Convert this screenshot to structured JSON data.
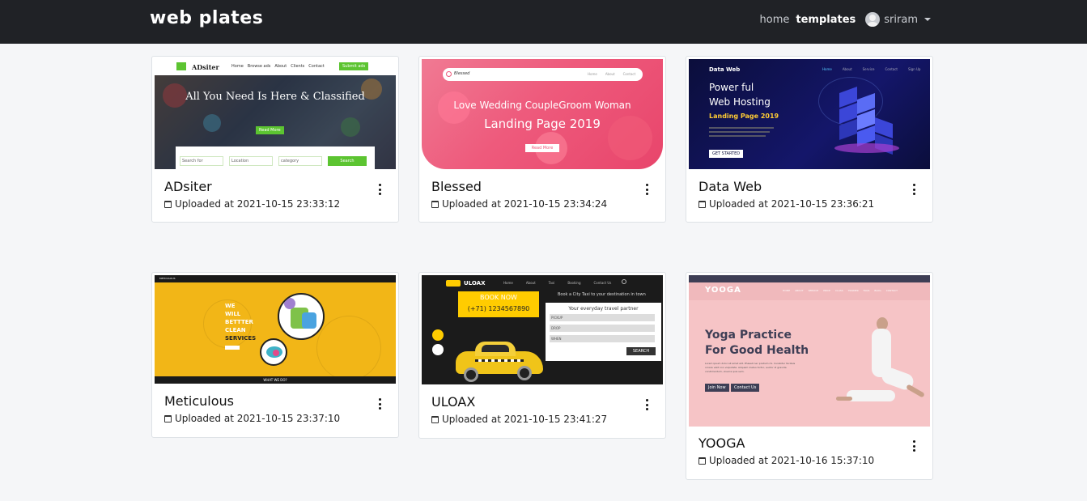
{
  "nav": {
    "brand": "web plates",
    "links": [
      "home",
      "templates"
    ],
    "active": "templates",
    "user": "sriram"
  },
  "cards": [
    {
      "title": "ADsiter",
      "uploaded": "Uploaded at 2021-10-15 23:33:12",
      "thumb": {
        "logo": "ADsiter",
        "menu": [
          "Home",
          "Browse ads",
          "About",
          "Clients",
          "Contact"
        ],
        "cta": "Submit ads",
        "headline": "All You Need Is Here & Classified",
        "button": "Read More",
        "fields": [
          "Search for",
          "Location",
          "category"
        ],
        "search": "Search"
      }
    },
    {
      "title": "Blessed",
      "uploaded": "Uploaded at 2021-10-15 23:34:24",
      "thumb": {
        "logo": "Blessed",
        "menu": [
          "Home",
          "About",
          "Contact"
        ],
        "line1": "Love Wedding CoupleGroom Woman",
        "line2": "Landing Page 2019",
        "button": "Read More"
      }
    },
    {
      "title": "Data Web",
      "uploaded": "Uploaded at 2021-10-15 23:36:21",
      "thumb": {
        "logo": "Data Web",
        "menu": [
          "Home",
          "About",
          "Service",
          "Contact",
          "Sign Up"
        ],
        "line1": "Power ful",
        "line2": "Web Hosting",
        "line3": "Landing Page 2019",
        "button": "GET STARTED"
      }
    },
    {
      "title": "Meticulous",
      "uploaded": "Uploaded at 2021-10-15 23:37:10",
      "thumb": {
        "logo": "METICULOUS",
        "lines": [
          "WE",
          "WILL",
          "BETTTER",
          "CLEAN",
          "SERVICES"
        ],
        "footer": "WHAT WE DO?"
      }
    },
    {
      "title": "ULOAX",
      "uploaded": "Uploaded at 2021-10-15 23:41:27",
      "thumb": {
        "logo": "ULOAX",
        "menu": [
          "Home",
          "About",
          "Taxi",
          "Booking",
          "Contact Us"
        ],
        "book": "BOOK NOW",
        "phone": "(+71) 1234567890",
        "tagline": "Book a City Taxi to your destination in town",
        "form_title": "Your everyday travel partner",
        "form_fields": [
          "PICKUP",
          "DROP",
          "WHEN"
        ],
        "form_button": "SEARCH"
      }
    },
    {
      "title": "YOOGA",
      "uploaded": "Uploaded at 2021-10-16 15:37:10",
      "thumb": {
        "logo": "YOOGA",
        "menu": [
          "HOME",
          "ABOUT",
          "SERVICE",
          "PRICE",
          "CLASS",
          "TRAINER",
          "FAQS",
          "BLOG",
          "CONTACT"
        ],
        "headline1": "Yoga Practice",
        "headline2": "For Good Health",
        "body": "Lorem ipsum dolor sit amet elit. Phasell nec pretium mi. Curabitur facilisis ornare velit non vulputate. Aliquam metus tortor, auctor id gravida condimentum, viverra quis sem.",
        "btn1": "Join Now",
        "btn2": "Contact Us"
      }
    }
  ],
  "colors": {
    "navbar": "#202226",
    "page_bg": "#f5f6f8",
    "adsiter_green": "#5cc431",
    "blessed_pink": "#ee5a7c",
    "dataweb_navy": "#0b0e3b",
    "meticulous_yellow": "#f2b617",
    "uloax_yellow": "#ffcc00",
    "yooga_pink": "#f6c4c6"
  }
}
